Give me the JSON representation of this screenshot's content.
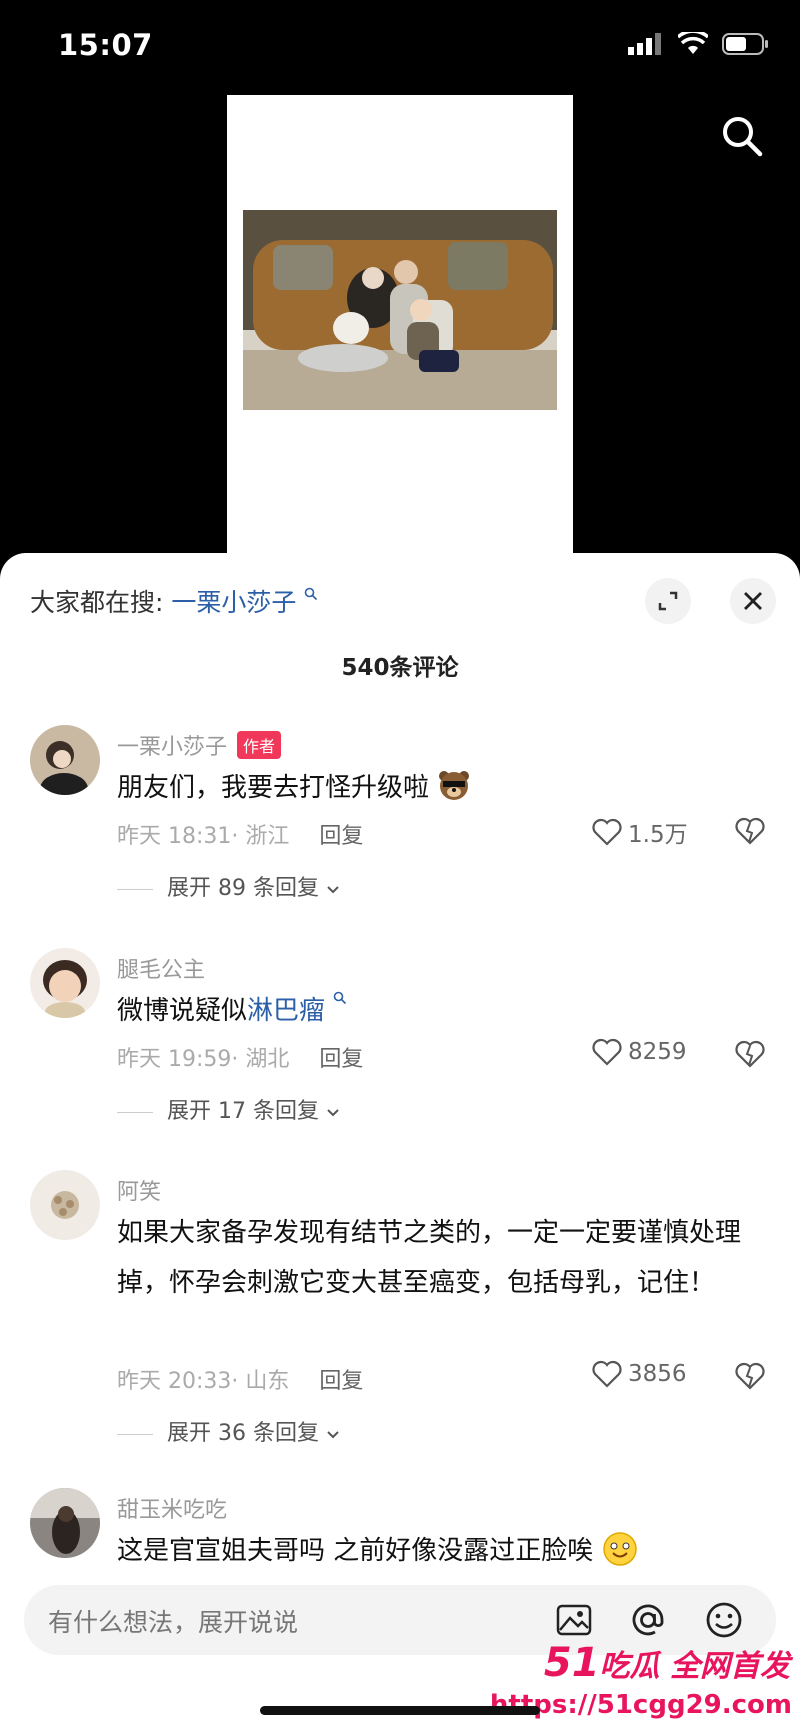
{
  "status_bar": {
    "time": "15:07"
  },
  "sheet": {
    "hot_search_label": "大家都在搜:",
    "hot_search_keyword": "一栗小莎子",
    "comment_count": "540条评论"
  },
  "comments": [
    {
      "user": "一栗小莎子",
      "badge": "作者",
      "text": "朋友们，我要去打怪升级啦",
      "time_loc": "昨天 18:31· 浙江",
      "reply": "回复",
      "likes": "1.5万",
      "expand": "展开 89 条回复"
    },
    {
      "user": "腿毛公主",
      "text_prefix": "微博说疑似",
      "keyword": "淋巴瘤",
      "time_loc": "昨天 19:59· 湖北",
      "reply": "回复",
      "likes": "8259",
      "expand": "展开 17 条回复"
    },
    {
      "user": "阿笑",
      "text": "如果大家备孕发现有结节之类的，一定一定要谨慎处理掉，怀孕会刺激它变大甚至癌变，包括母乳，记住！",
      "time_loc": "昨天 20:33· 山东",
      "reply": "回复",
      "likes": "3856",
      "expand": "展开 36 条回复"
    },
    {
      "user": "甜玉米吃吃",
      "text": "这是官宣姐夫哥吗 之前好像没露过正脸唉"
    }
  ],
  "input": {
    "placeholder": "有什么想法，展开说说"
  },
  "watermark": {
    "brand_num": "51",
    "brand_text": "吃瓜 全网首发",
    "url": "https://51cgg29.com"
  },
  "colors": {
    "accent_link": "#2b5fa8",
    "author_badge": "#f2385a",
    "watermark": "#e8155e"
  }
}
